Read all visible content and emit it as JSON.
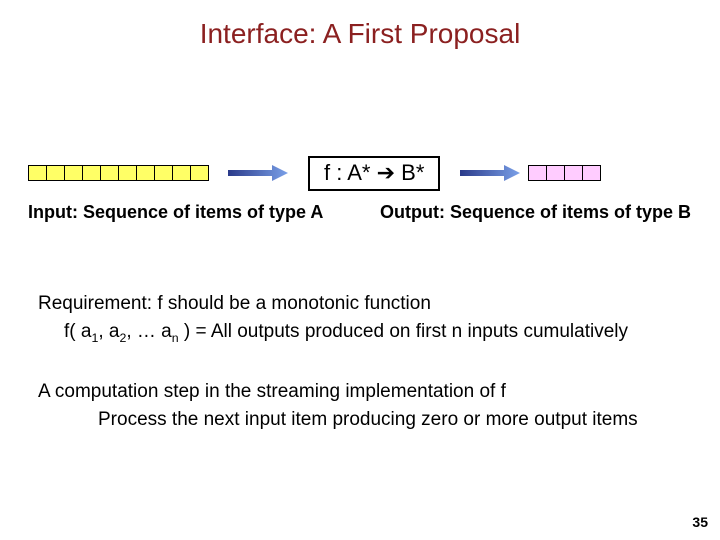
{
  "title": "Interface: A First Proposal",
  "fbox": {
    "lhs": "f : A* ",
    "arrow": "➔",
    "rhs": " B*"
  },
  "caption_left": "Input: Sequence of items of type A",
  "caption_right": "Output: Sequence of items of type B",
  "req": {
    "line1": "Requirement: f should be a monotonic function",
    "line2_pre": "f( a",
    "line2_mid1": ", a",
    "line2_mid2": ", … a",
    "line2_post": " ) = All outputs produced on first n inputs cumulatively",
    "sub1": "1",
    "sub2": "2",
    "subn": "n"
  },
  "comp": {
    "line1": "A computation step in the streaming implementation of f",
    "line2": "Process the next input item producing zero or more output items"
  },
  "left_box_count": 10,
  "right_box_count": 4,
  "pagenum": "35"
}
